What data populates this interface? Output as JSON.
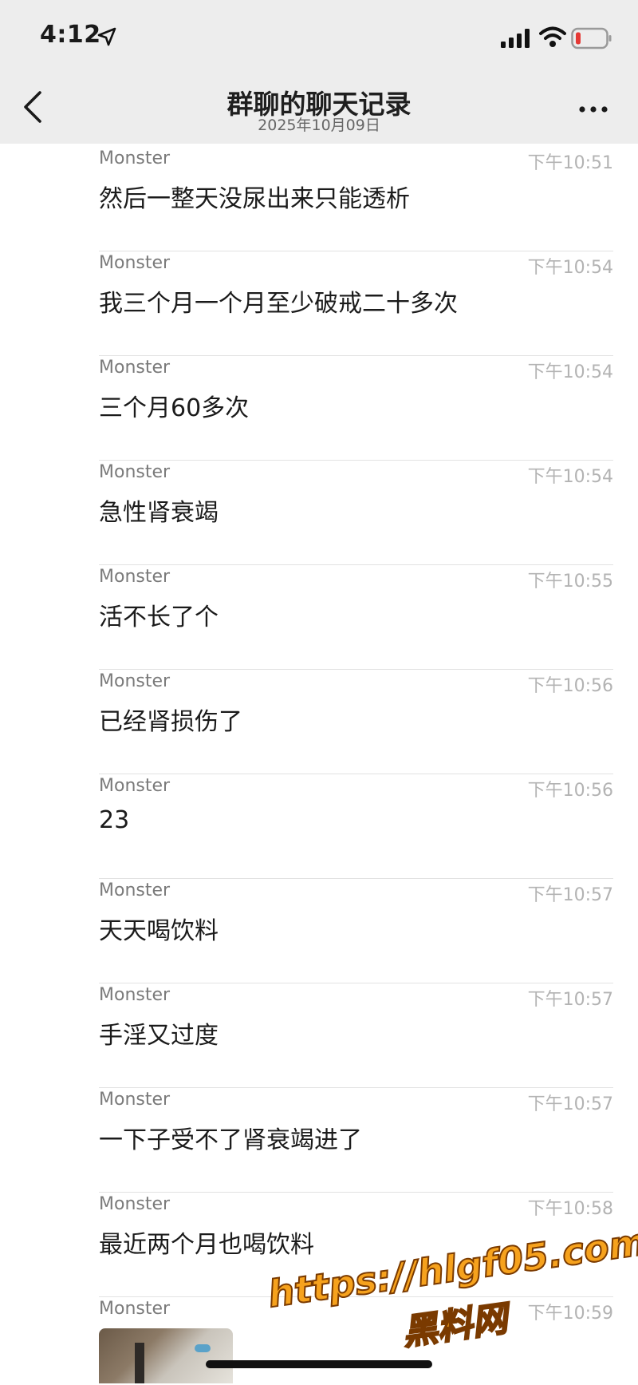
{
  "status_bar": {
    "time": "4:12",
    "icons": [
      "location-arrow-icon",
      "signal-bars-icon",
      "wifi-icon",
      "battery-low-icon"
    ],
    "battery_color": "#e53935"
  },
  "nav": {
    "title": "群聊的聊天记录",
    "subtitle": "2025年10月09日",
    "back_icon": "chevron-left-icon",
    "more_icon": "more-dots-icon"
  },
  "messages": [
    {
      "sender": "Monster",
      "time": "下午10:51",
      "text": "然后一整天没尿出来只能透析"
    },
    {
      "sender": "Monster",
      "time": "下午10:54",
      "text": "我三个月一个月至少破戒二十多次"
    },
    {
      "sender": "Monster",
      "time": "下午10:54",
      "text": "三个月60多次"
    },
    {
      "sender": "Monster",
      "time": "下午10:54",
      "text": "急性肾衰竭"
    },
    {
      "sender": "Monster",
      "time": "下午10:55",
      "text": "活不长了个"
    },
    {
      "sender": "Monster",
      "time": "下午10:56",
      "text": "已经肾损伤了"
    },
    {
      "sender": "Monster",
      "time": "下午10:56",
      "text": "23"
    },
    {
      "sender": "Monster",
      "time": "下午10:57",
      "text": "天天喝饮料"
    },
    {
      "sender": "Monster",
      "time": "下午10:57",
      "text": "手淫又过度"
    },
    {
      "sender": "Monster",
      "time": "下午10:57",
      "text": "一下子受不了肾衰竭进了"
    },
    {
      "sender": "Monster",
      "time": "下午10:58",
      "text": "最近两个月也喝饮料"
    },
    {
      "sender": "Monster",
      "time": "下午10:59",
      "text": ""
    }
  ],
  "watermark": {
    "url": "https://hlgf05.com",
    "label": "黑料网"
  }
}
